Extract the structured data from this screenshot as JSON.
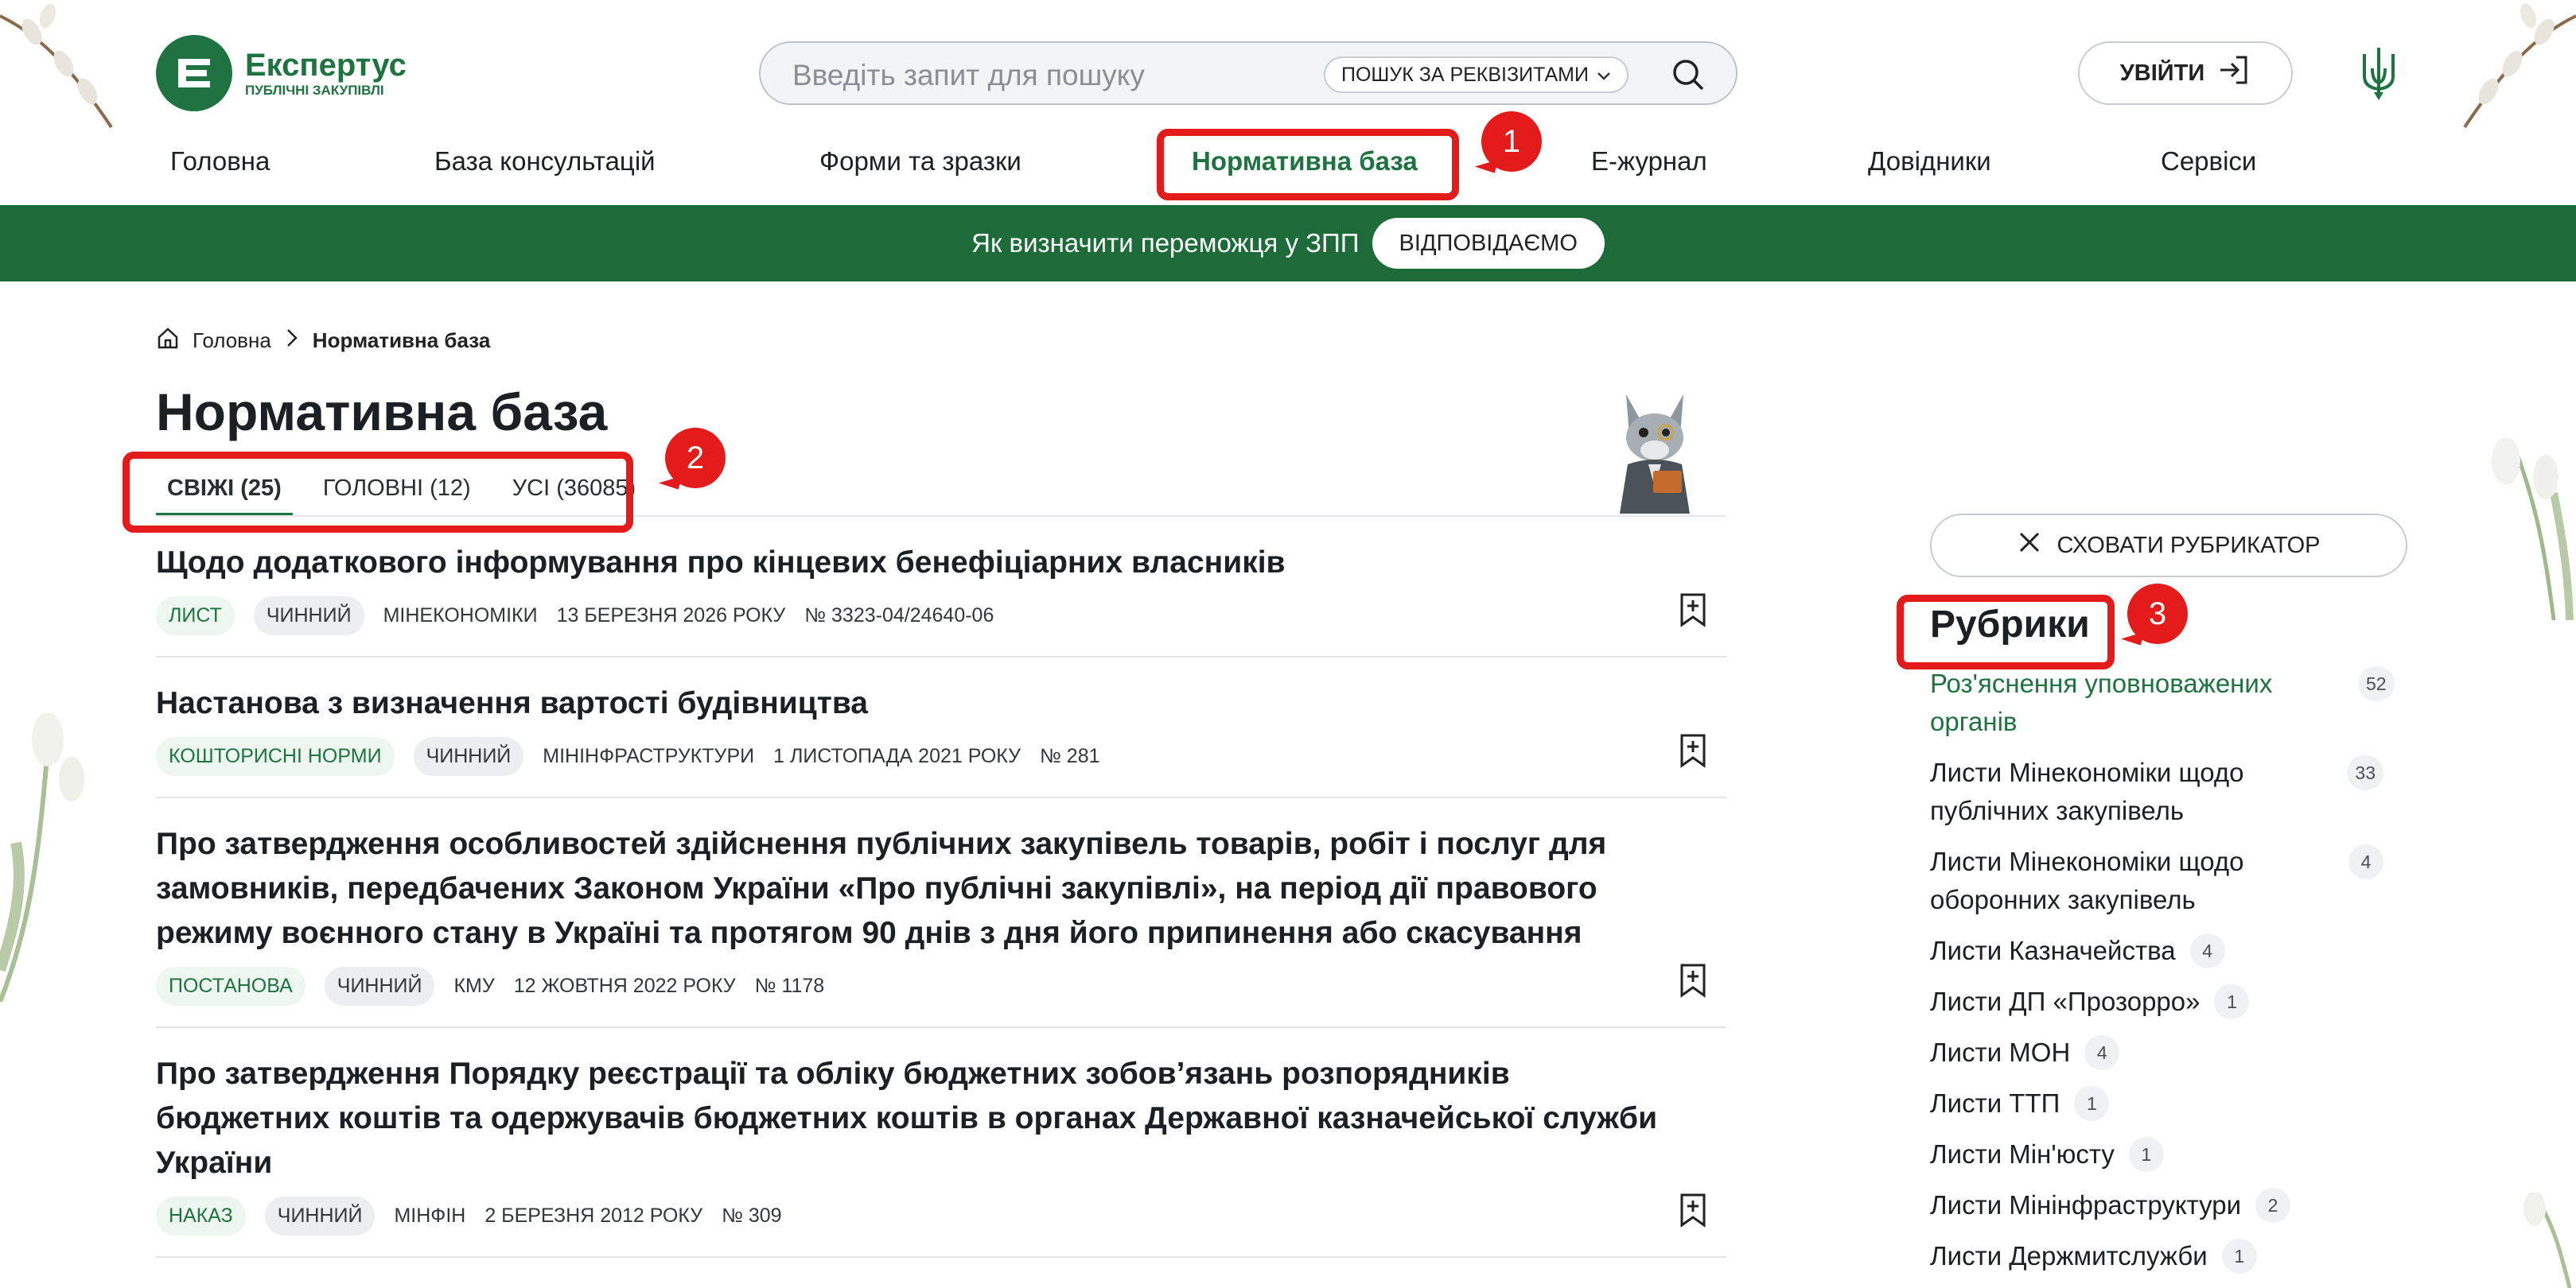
{
  "logo": {
    "name": "Експертус",
    "subtitle": "ПУБЛІЧНІ ЗАКУПІВЛІ"
  },
  "search": {
    "placeholder": "Введіть запит для пошуку",
    "requisites_button": "ПОШУК ЗА РЕКВІЗИТАМИ"
  },
  "login": {
    "label": "УВІЙТИ"
  },
  "nav": {
    "items": [
      {
        "label": "Головна"
      },
      {
        "label": "База консультацій"
      },
      {
        "label": "Форми та зразки"
      },
      {
        "label": "Нормативна база",
        "active": true
      },
      {
        "label": "Е-журнал"
      },
      {
        "label": "Довідники"
      },
      {
        "label": "Сервіси"
      }
    ]
  },
  "banner": {
    "text": "Як визначити переможця у ЗПП",
    "button": "ВІДПОВІДАЄМО"
  },
  "breadcrumb": {
    "home": "Головна",
    "current": "Нормативна база"
  },
  "page": {
    "title": "Нормативна база"
  },
  "tabs": [
    {
      "label": "СВІЖІ (25)",
      "active": true
    },
    {
      "label": "ГОЛОВНІ (12)"
    },
    {
      "label": "УСІ (36085)"
    }
  ],
  "documents": [
    {
      "title": "Щодо додаткового інформування про кінцевих бенефіціарних власників",
      "type": "ЛИСТ",
      "status": "ЧИННИЙ",
      "issuer": "МІНЕКОНОМІКИ",
      "date": "13 БЕРЕЗНЯ 2026 РОКУ",
      "number": "№ 3323-04/24640-06"
    },
    {
      "title": "Настанова з визначення вартості будівництва",
      "type": "КОШТОРИСНІ НОРМИ",
      "status": "ЧИННИЙ",
      "issuer": "МІНІНФРАСТРУКТУРИ",
      "date": "1 ЛИСТОПАДА 2021 РОКУ",
      "number": "№ 281"
    },
    {
      "title": "Про затвердження особливостей здійснення публічних закупівель товарів, робіт і послуг для замовників, передбачених Законом України «Про публічні закупівлі», на період дії правового режиму воєнного стану в Україні та протягом 90 днів з дня його припинення або скасування",
      "type": "ПОСТАНОВА",
      "status": "ЧИННИЙ",
      "issuer": "КМУ",
      "date": "12 ЖОВТНЯ 2022 РОКУ",
      "number": "№ 1178"
    },
    {
      "title": "Про затвердження Порядку реєстрації та обліку бюджетних зобов’язань розпорядників бюджетних коштів та одержувачів бюджетних коштів в органах Державної казначейської служби України",
      "type": "НАКАЗ",
      "status": "ЧИННИЙ",
      "issuer": "МІНФІН",
      "date": "2 БЕРЕЗНЯ 2012 РОКУ",
      "number": "№ 309"
    }
  ],
  "sidebar": {
    "hide_button": "СХОВАТИ РУБРИКАТОР",
    "title": "Рубрики",
    "rubrics": [
      {
        "label": "Роз'яснення уповноважених органів",
        "count": "52",
        "active": true
      },
      {
        "label": "Листи Мінекономіки щодо публічних закупівель",
        "count": "33"
      },
      {
        "label": "Листи Мінекономіки щодо оборонних закупівель",
        "count": "4"
      },
      {
        "label": "Листи Казначейства",
        "count": "4"
      },
      {
        "label": "Листи ДП «Прозорро»",
        "count": "1"
      },
      {
        "label": "Листи МОН",
        "count": "4"
      },
      {
        "label": "Листи ТТП",
        "count": "1"
      },
      {
        "label": "Листи Мін'юсту",
        "count": "1"
      },
      {
        "label": "Листи Мінінфраструктури",
        "count": "2"
      },
      {
        "label": "Листи Держмитслужби",
        "count": "1"
      }
    ]
  },
  "annotations": [
    {
      "label": "1"
    },
    {
      "label": "2"
    },
    {
      "label": "3"
    }
  ],
  "colors": {
    "brand_green": "#1e7340",
    "banner_green": "#1e6b3a",
    "annotation_red": "#e31b1b"
  }
}
